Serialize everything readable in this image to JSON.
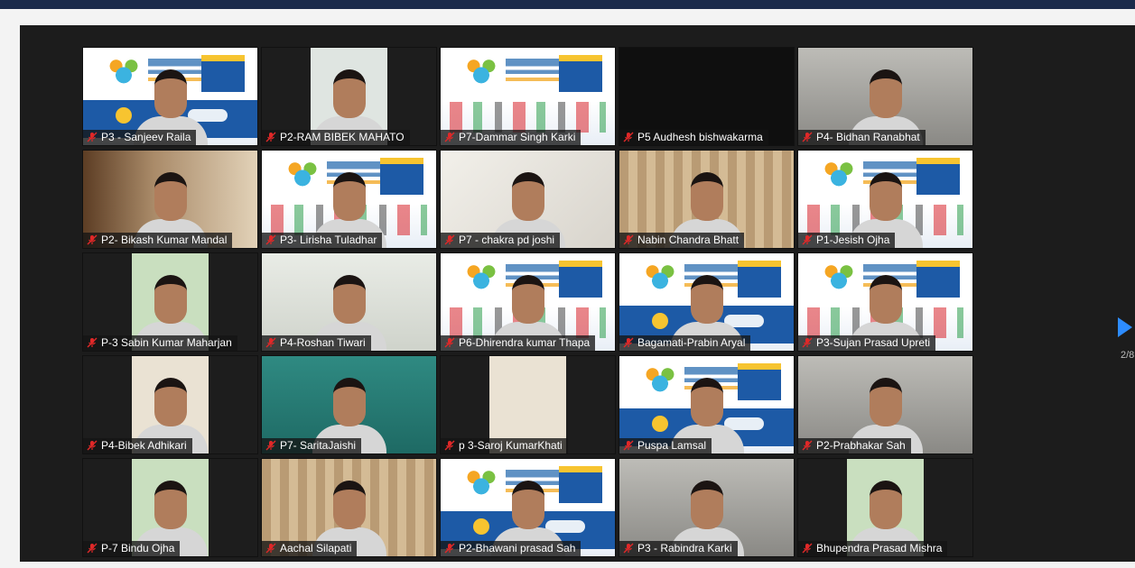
{
  "participants": [
    {
      "name": "P3 - Sanjeev Raila",
      "scene": "poster blue",
      "person": true
    },
    {
      "name": "P2-RAM BIBEK MAHATO",
      "scene": "pillar",
      "person": true
    },
    {
      "name": "P7-Dammar Singh Karki",
      "scene": "poster",
      "person": false
    },
    {
      "name": "P5 Audhesh bishwakarma",
      "scene": "dark",
      "person": false
    },
    {
      "name": "P4- Bidhan Ranabhat",
      "scene": "greyroom",
      "person": true
    },
    {
      "name": "P2- Bikash Kumar Mandal",
      "scene": "wall-warm",
      "person": true
    },
    {
      "name": "P3- Lirisha Tuladhar",
      "scene": "poster",
      "person": true
    },
    {
      "name": "P7 - chakra pd joshi",
      "scene": "paper",
      "person": true
    },
    {
      "name": "Nabin Chandra Bhatt",
      "scene": "curtain",
      "person": true
    },
    {
      "name": "P1-Jesish Ojha",
      "scene": "poster",
      "person": true
    },
    {
      "name": "P-3 Sabin Kumar Maharjan",
      "scene": "pillar-green",
      "person": true
    },
    {
      "name": "P4-Roshan Tiwari",
      "scene": "wall-light",
      "person": true
    },
    {
      "name": "P6-Dhirendra kumar Thapa",
      "scene": "poster",
      "person": true
    },
    {
      "name": "Bagamati-Prabin Aryal",
      "scene": "poster blue",
      "person": true
    },
    {
      "name": "P3-Sujan Prasad Upreti",
      "scene": "poster",
      "person": true
    },
    {
      "name": "P4-Bibek Adhikari",
      "scene": "pillar-beige",
      "person": true
    },
    {
      "name": "P7- SaritaJaishi",
      "scene": "teal",
      "person": true
    },
    {
      "name": "p 3-Saroj KumarKhati",
      "scene": "pillar-beige",
      "person": false
    },
    {
      "name": "Puspa Lamsal",
      "scene": "poster blue",
      "person": true
    },
    {
      "name": "P2-Prabhakar Sah",
      "scene": "greyroom",
      "person": true
    },
    {
      "name": "P-7 Bindu Ojha",
      "scene": "pillar-green",
      "person": true
    },
    {
      "name": "Aachal Silapati",
      "scene": "curtain",
      "person": true
    },
    {
      "name": "P2-Bhawani prasad Sah",
      "scene": "poster blue",
      "person": true
    },
    {
      "name": "P3 - Rabindra Karki",
      "scene": "greyroom",
      "person": true
    },
    {
      "name": "Bhupendra Prasad Mishra",
      "scene": "pillar-green",
      "person": true
    }
  ],
  "pagination": {
    "indicator": "2/8"
  },
  "icons": {
    "muted": "mic-muted-icon",
    "next": "chevron-right-icon"
  },
  "colors": {
    "next_arrow": "#2d8cff",
    "mute_red": "#e02828",
    "topbar": "#1b2a4b"
  }
}
